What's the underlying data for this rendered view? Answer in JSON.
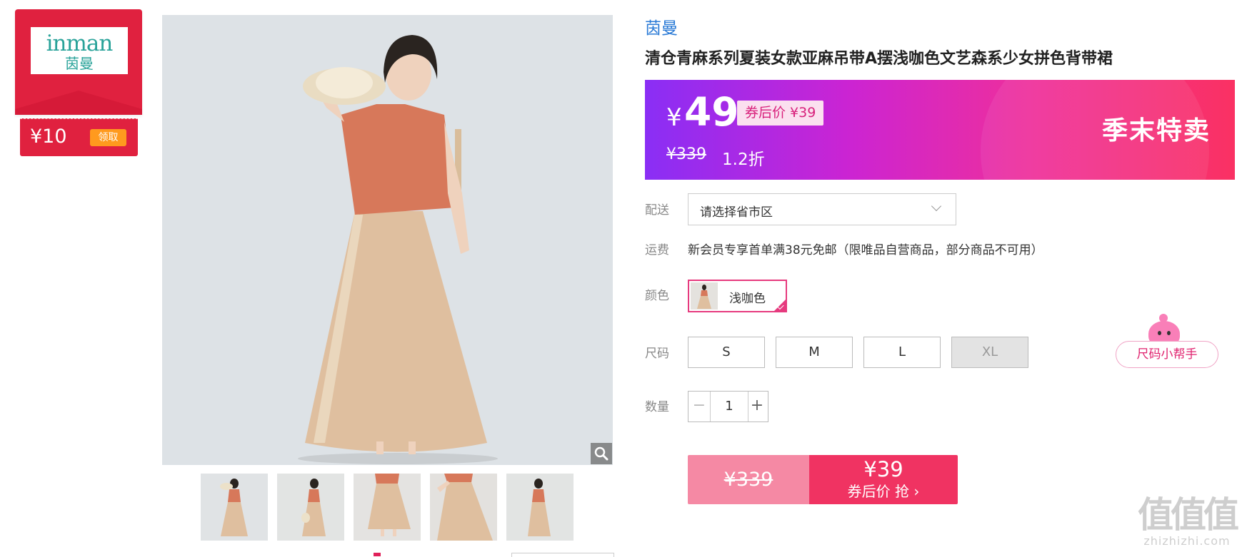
{
  "brand_coupon": {
    "logo_en": "inman",
    "logo_cn": "茵曼",
    "amount": "¥10",
    "claim_label": "领取"
  },
  "gallery": {
    "thumbnail_count": 5
  },
  "product": {
    "brand": "茵曼",
    "title": "清仓青麻系列夏装女款亚麻吊带A摆浅咖色文艺森系少女拼色背带裙"
  },
  "price_banner": {
    "currency": "¥",
    "price": "49",
    "after_coupon": "券后价 ¥39",
    "original_price": "¥339",
    "discount": "1.2折",
    "promo_tag": "季末特卖"
  },
  "delivery": {
    "label": "配送",
    "select_value": "请选择省市区"
  },
  "shipping": {
    "label": "运费",
    "text": "新会员专享首单满38元免邮（限唯品自营商品，部分商品不可用）"
  },
  "color": {
    "label": "颜色",
    "selected": "浅咖色"
  },
  "size": {
    "label": "尺码",
    "options": [
      "S",
      "M",
      "L",
      "XL"
    ],
    "disabled": [
      "XL"
    ],
    "helper": "尺码小帮手"
  },
  "quantity": {
    "label": "数量",
    "minus": "−",
    "value": "1",
    "plus": "+"
  },
  "buy_button": {
    "original_price": "¥339",
    "coupon_price": "¥39",
    "action": "券后价 抢 ›"
  },
  "watermark": {
    "big": "值值值",
    "small": "zhizhizhi.com"
  },
  "colors": {
    "accent_pink": "#f03362",
    "brand_red": "#e0213f",
    "link_blue": "#2a7ad6"
  }
}
